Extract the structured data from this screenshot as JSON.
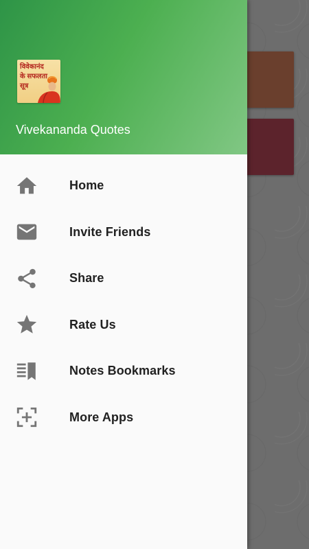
{
  "background": {
    "card_colors": [
      "#6a3f2d",
      "#5c232c"
    ]
  },
  "drawer": {
    "header": {
      "app_icon_text": "विवेकानंद के सफलता सूत्र",
      "title": "Vivekananda Quotes",
      "gradient_colors": [
        "#2e9447",
        "#81c784"
      ]
    },
    "menu": [
      {
        "label": "Home",
        "icon": "home-icon"
      },
      {
        "label": "Invite Friends",
        "icon": "email-icon"
      },
      {
        "label": "Share",
        "icon": "share-icon"
      },
      {
        "label": "Rate Us",
        "icon": "star-icon"
      },
      {
        "label": "Notes Bookmarks",
        "icon": "bookmark-list-icon"
      },
      {
        "label": "More Apps",
        "icon": "add-box-icon"
      }
    ],
    "icon_color": "#757575"
  }
}
